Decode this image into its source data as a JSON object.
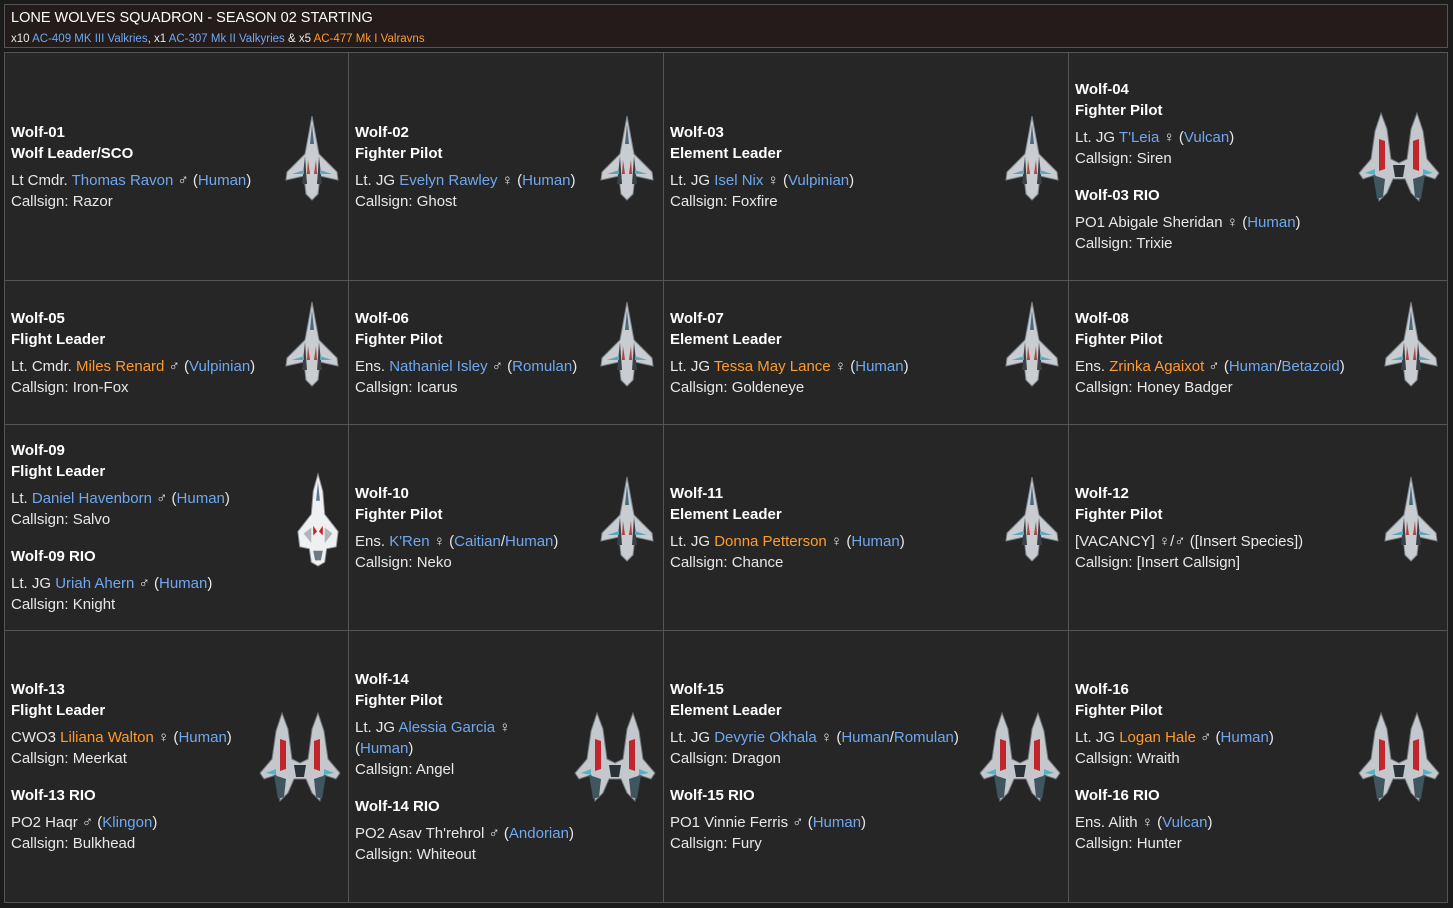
{
  "header": {
    "title": "LONE WOLVES SQUADRON - SEASON 02 STARTING",
    "subtitle": [
      {
        "t": "x10 ",
        "c": "white"
      },
      {
        "t": "AC-409 MK III Valkries",
        "c": "blue"
      },
      {
        "t": ", x1 ",
        "c": "white"
      },
      {
        "t": "AC-307 Mk II Valkyries",
        "c": "blue"
      },
      {
        "t": " & x5 ",
        "c": "white"
      },
      {
        "t": "AC-477 Mk I Valravns",
        "c": "orange"
      }
    ]
  },
  "colors": {
    "link_blue": "#6fa8f0",
    "link_orange": "#ff9a2e",
    "cell_bg": "#262626",
    "border": "#555555"
  },
  "cells": [
    {
      "ship": "small-fighter-icon",
      "blocks": [
        {
          "heading": [
            "Wolf-01",
            "Wolf Leader/SCO"
          ],
          "name": [
            {
              "t": "Lt Cmdr. ",
              "c": "white"
            },
            {
              "t": "Thomas Ravon",
              "c": "blue"
            },
            {
              "t": " ♂ (",
              "c": "white"
            },
            {
              "t": "Human",
              "c": "blue"
            },
            {
              "t": ")",
              "c": "white"
            }
          ],
          "callsign": "Callsign: Razor"
        }
      ]
    },
    {
      "ship": "small-fighter-icon",
      "blocks": [
        {
          "heading": [
            "Wolf-02",
            "Fighter Pilot"
          ],
          "name": [
            {
              "t": "Lt. JG ",
              "c": "white"
            },
            {
              "t": "Evelyn Rawley",
              "c": "blue"
            },
            {
              "t": " ♀ (",
              "c": "white"
            },
            {
              "t": "Human",
              "c": "blue"
            },
            {
              "t": ")",
              "c": "white"
            }
          ],
          "callsign": "Callsign: Ghost"
        }
      ]
    },
    {
      "ship": "small-fighter-icon",
      "blocks": [
        {
          "heading": [
            "Wolf-03",
            "Element Leader"
          ],
          "name": [
            {
              "t": "Lt. JG ",
              "c": "white"
            },
            {
              "t": "Isel Nix",
              "c": "blue"
            },
            {
              "t": " ♀ (",
              "c": "white"
            },
            {
              "t": "Vulpinian",
              "c": "blue"
            },
            {
              "t": ")",
              "c": "white"
            }
          ],
          "callsign": "Callsign: Foxfire"
        }
      ]
    },
    {
      "ship": "heavy-fighter-icon",
      "blocks": [
        {
          "heading": [
            "Wolf-04",
            "Fighter Pilot"
          ],
          "name": [
            {
              "t": "Lt. JG ",
              "c": "white"
            },
            {
              "t": "T'Leia",
              "c": "blue"
            },
            {
              "t": " ♀ (",
              "c": "white"
            },
            {
              "t": "Vulcan",
              "c": "blue"
            },
            {
              "t": ")",
              "c": "white"
            }
          ],
          "callsign": "Callsign: Siren"
        },
        {
          "heading": [
            "Wolf-03 RIO"
          ],
          "name": [
            {
              "t": "PO1 Abigale Sheridan ♀ (",
              "c": "white"
            },
            {
              "t": "Human",
              "c": "blue"
            },
            {
              "t": ")",
              "c": "white"
            }
          ],
          "callsign": "Callsign: Trixie"
        }
      ]
    },
    {
      "ship": "small-fighter-icon",
      "blocks": [
        {
          "heading": [
            "Wolf-05",
            "Flight Leader"
          ],
          "name": [
            {
              "t": "Lt. Cmdr. ",
              "c": "white"
            },
            {
              "t": "Miles Renard",
              "c": "orange"
            },
            {
              "t": " ♂ (",
              "c": "white"
            },
            {
              "t": "Vulpinian",
              "c": "blue"
            },
            {
              "t": ")",
              "c": "white"
            }
          ],
          "callsign": "Callsign: Iron-Fox"
        }
      ]
    },
    {
      "ship": "small-fighter-icon",
      "blocks": [
        {
          "heading": [
            "Wolf-06",
            "Fighter Pilot"
          ],
          "name": [
            {
              "t": "Ens. ",
              "c": "white"
            },
            {
              "t": "Nathaniel Isley",
              "c": "blue"
            },
            {
              "t": " ♂ (",
              "c": "white"
            },
            {
              "t": "Romulan",
              "c": "blue"
            },
            {
              "t": ")",
              "c": "white"
            }
          ],
          "callsign": "Callsign: Icarus"
        }
      ]
    },
    {
      "ship": "small-fighter-icon",
      "blocks": [
        {
          "heading": [
            "Wolf-07",
            "Element Leader"
          ],
          "name": [
            {
              "t": "Lt. JG ",
              "c": "white"
            },
            {
              "t": "Tessa May Lance",
              "c": "orange"
            },
            {
              "t": " ♀ (",
              "c": "white"
            },
            {
              "t": "Human",
              "c": "blue"
            },
            {
              "t": ")",
              "c": "white"
            }
          ],
          "callsign": "Callsign: Goldeneye"
        }
      ]
    },
    {
      "ship": "small-fighter-icon",
      "blocks": [
        {
          "heading": [
            "Wolf-08",
            "Fighter Pilot"
          ],
          "name": [
            {
              "t": "Ens. ",
              "c": "white"
            },
            {
              "t": "Zrinka Agaixot",
              "c": "orange"
            },
            {
              "t": " ♂ (",
              "c": "white"
            },
            {
              "t": "Human",
              "c": "blue"
            },
            {
              "t": "/",
              "c": "white"
            },
            {
              "t": "Betazoid",
              "c": "blue"
            },
            {
              "t": ")",
              "c": "white"
            }
          ],
          "callsign": "Callsign: Honey Badger"
        }
      ]
    },
    {
      "ship": "white-interceptor-icon",
      "blocks": [
        {
          "heading": [
            "Wolf-09",
            "Flight Leader"
          ],
          "name": [
            {
              "t": "Lt. ",
              "c": "white"
            },
            {
              "t": "Daniel Havenborn",
              "c": "blue"
            },
            {
              "t": " ♂ (",
              "c": "white"
            },
            {
              "t": "Human",
              "c": "blue"
            },
            {
              "t": ")",
              "c": "white"
            }
          ],
          "callsign": "Callsign: Salvo"
        },
        {
          "heading": [
            "Wolf-09 RIO"
          ],
          "name": [
            {
              "t": "Lt. JG ",
              "c": "white"
            },
            {
              "t": "Uriah Ahern",
              "c": "blue"
            },
            {
              "t": " ♂ (",
              "c": "white"
            },
            {
              "t": "Human",
              "c": "blue"
            },
            {
              "t": ")",
              "c": "white"
            }
          ],
          "callsign": "Callsign: Knight"
        }
      ]
    },
    {
      "ship": "small-fighter-icon",
      "blocks": [
        {
          "heading": [
            "Wolf-10",
            "Fighter Pilot"
          ],
          "name": [
            {
              "t": "Ens. ",
              "c": "white"
            },
            {
              "t": "K'Ren",
              "c": "blue"
            },
            {
              "t": " ♀ (",
              "c": "white"
            },
            {
              "t": "Caitian",
              "c": "blue"
            },
            {
              "t": "/",
              "c": "white"
            },
            {
              "t": "Human",
              "c": "blue"
            },
            {
              "t": ")",
              "c": "white"
            }
          ],
          "callsign": "Callsign: Neko"
        }
      ]
    },
    {
      "ship": "small-fighter-icon",
      "blocks": [
        {
          "heading": [
            "Wolf-11",
            "Element Leader"
          ],
          "name": [
            {
              "t": "Lt. JG ",
              "c": "white"
            },
            {
              "t": "Donna Petterson",
              "c": "orange"
            },
            {
              "t": " ♀ (",
              "c": "white"
            },
            {
              "t": "Human",
              "c": "blue"
            },
            {
              "t": ")",
              "c": "white"
            }
          ],
          "callsign": "Callsign: Chance"
        }
      ]
    },
    {
      "ship": "small-fighter-icon",
      "blocks": [
        {
          "heading": [
            "Wolf-12",
            "Fighter Pilot"
          ],
          "name": [
            {
              "t": "[VACANCY] ♀/♂ ([Insert Species])",
              "c": "white"
            }
          ],
          "callsign": "Callsign: [Insert Callsign]"
        }
      ]
    },
    {
      "ship": "heavy-fighter-icon",
      "blocks": [
        {
          "heading": [
            "Wolf-13",
            "Flight Leader"
          ],
          "name": [
            {
              "t": "CWO3 ",
              "c": "white"
            },
            {
              "t": "Liliana Walton",
              "c": "orange"
            },
            {
              "t": " ♀ (",
              "c": "white"
            },
            {
              "t": "Human",
              "c": "blue"
            },
            {
              "t": ")",
              "c": "white"
            }
          ],
          "callsign": "Callsign: Meerkat"
        },
        {
          "heading": [
            "Wolf-13 RIO"
          ],
          "name": [
            {
              "t": "PO2 Haqr ♂ (",
              "c": "white"
            },
            {
              "t": "Klingon",
              "c": "blue"
            },
            {
              "t": ")",
              "c": "white"
            }
          ],
          "callsign": "Callsign: Bulkhead"
        }
      ]
    },
    {
      "ship": "heavy-fighter-icon",
      "blocks": [
        {
          "heading": [
            "Wolf-14",
            "Fighter Pilot"
          ],
          "name": [
            {
              "t": "Lt. JG ",
              "c": "white"
            },
            {
              "t": "Alessia Garcia",
              "c": "blue"
            },
            {
              "t": " ♀",
              "c": "white"
            }
          ],
          "name2": [
            {
              "t": "(",
              "c": "white"
            },
            {
              "t": "Human",
              "c": "blue"
            },
            {
              "t": ")",
              "c": "white"
            }
          ],
          "callsign": "Callsign: Angel"
        },
        {
          "heading": [
            "Wolf-14 RIO"
          ],
          "name": [
            {
              "t": "PO2 Asav Th'rehrol ♂ (",
              "c": "white"
            },
            {
              "t": "Andorian",
              "c": "blue"
            },
            {
              "t": ")",
              "c": "white"
            }
          ],
          "callsign": "Callsign: Whiteout"
        }
      ]
    },
    {
      "ship": "heavy-fighter-icon",
      "blocks": [
        {
          "heading": [
            "Wolf-15",
            "Element Leader"
          ],
          "name": [
            {
              "t": "Lt. JG ",
              "c": "white"
            },
            {
              "t": "Devyrie Okhala",
              "c": "blue"
            },
            {
              "t": " ♀ (",
              "c": "white"
            },
            {
              "t": "Human",
              "c": "blue"
            },
            {
              "t": "/",
              "c": "white"
            },
            {
              "t": "Romulan",
              "c": "blue"
            },
            {
              "t": ")",
              "c": "white"
            }
          ],
          "callsign": "Callsign: Dragon"
        },
        {
          "heading": [
            "Wolf-15 RIO"
          ],
          "name": [
            {
              "t": "PO1 Vinnie Ferris ♂ (",
              "c": "white"
            },
            {
              "t": "Human",
              "c": "blue"
            },
            {
              "t": ")",
              "c": "white"
            }
          ],
          "callsign": "Callsign: Fury"
        }
      ]
    },
    {
      "ship": "heavy-fighter-icon",
      "blocks": [
        {
          "heading": [
            "Wolf-16",
            "Fighter Pilot"
          ],
          "name": [
            {
              "t": "Lt. JG ",
              "c": "white"
            },
            {
              "t": "Logan Hale",
              "c": "orange"
            },
            {
              "t": " ♂ (",
              "c": "white"
            },
            {
              "t": "Human",
              "c": "blue"
            },
            {
              "t": ")",
              "c": "white"
            }
          ],
          "callsign": "Callsign: Wraith"
        },
        {
          "heading": [
            "Wolf-16 RIO"
          ],
          "name": [
            {
              "t": "Ens. Alith ♀ (",
              "c": "white"
            },
            {
              "t": "Vulcan",
              "c": "blue"
            },
            {
              "t": ")",
              "c": "white"
            }
          ],
          "callsign": "Callsign: Hunter"
        }
      ]
    }
  ]
}
